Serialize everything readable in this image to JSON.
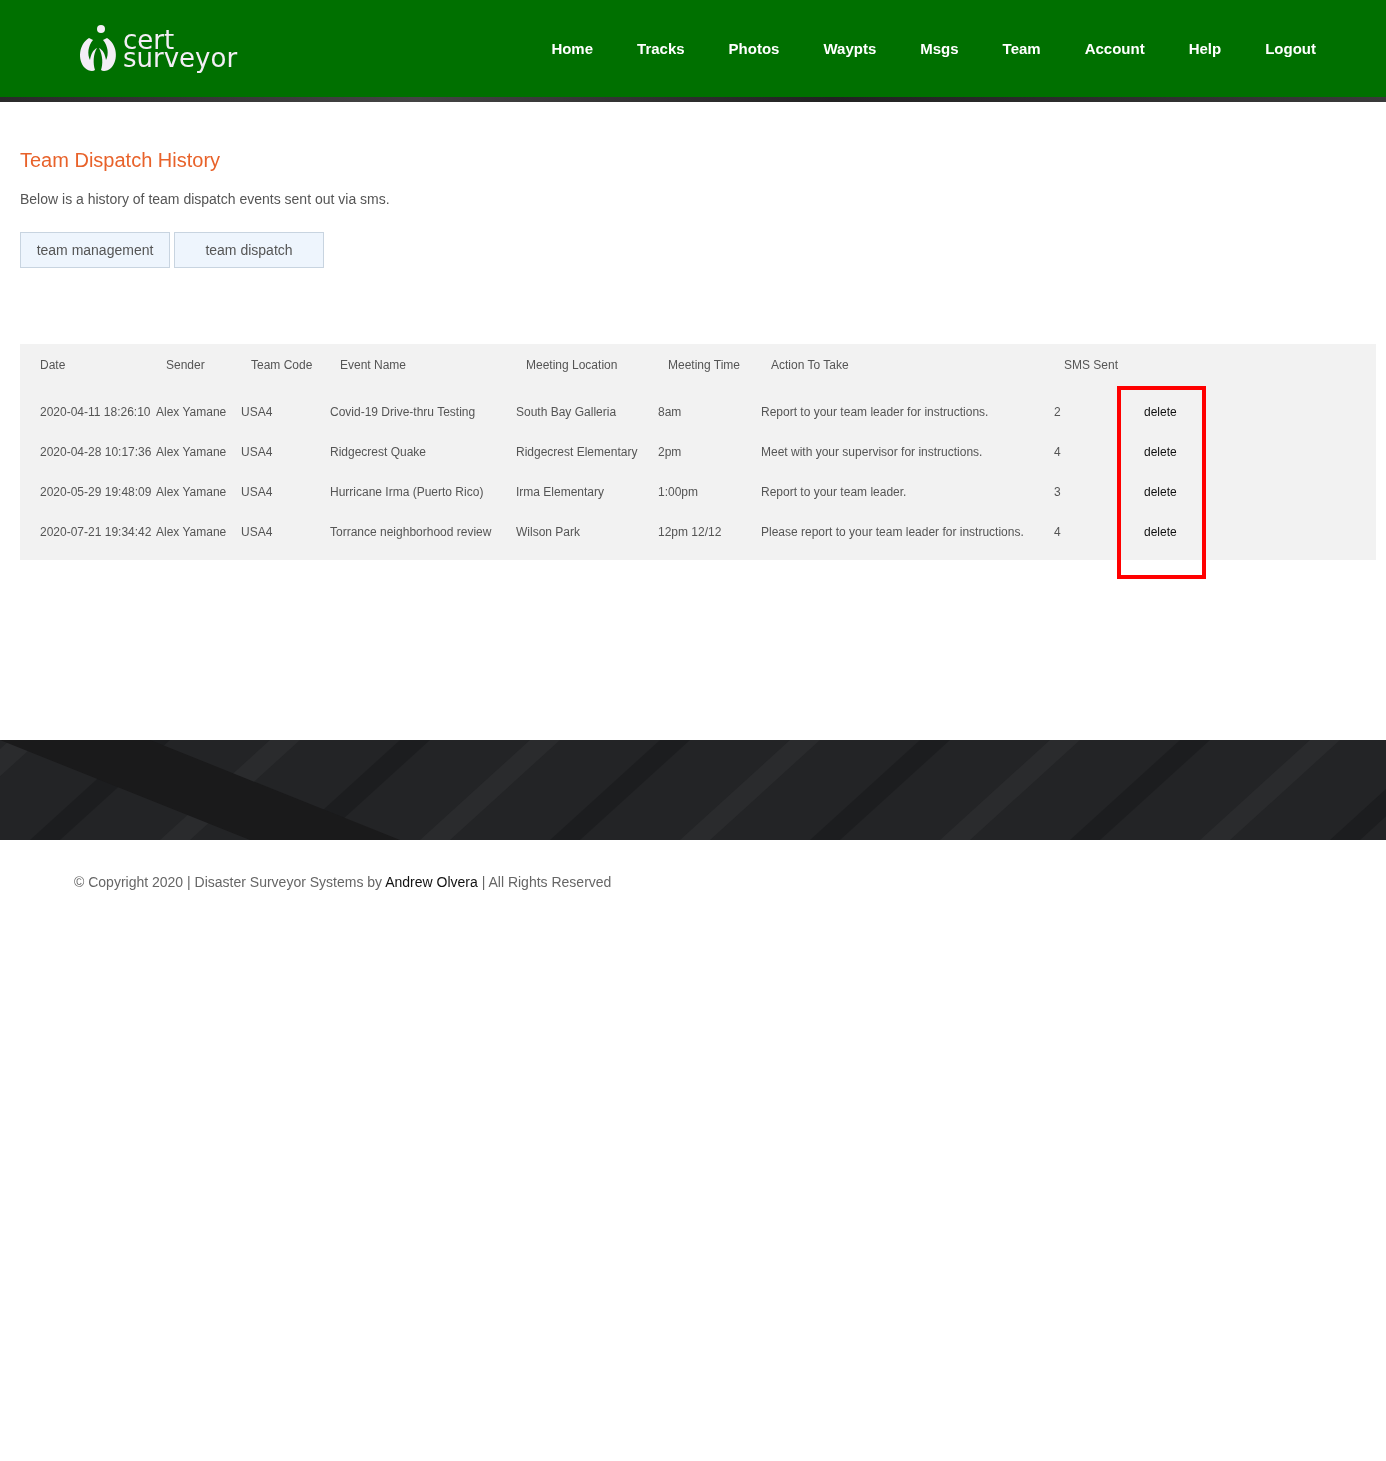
{
  "logo": {
    "line_1": "cert",
    "line_2": "surveyor"
  },
  "nav": [
    "Home",
    "Tracks",
    "Photos",
    "Waypts",
    "Msgs",
    "Team",
    "Account",
    "Help",
    "Logout"
  ],
  "page_title": "Team Dispatch History",
  "intro": "Below is a history of team dispatch events sent out via sms.",
  "buttons": [
    "team management",
    "team dispatch"
  ],
  "table": {
    "columns": [
      "Date",
      "Sender",
      "Team Code",
      "Event Name",
      "Meeting Location",
      "Meeting Time",
      "Action To Take",
      "SMS Sent"
    ],
    "rows": [
      {
        "cells": [
          "2020-04-11 18:26:10",
          "Alex Yamane",
          "USA4",
          "Covid-19 Drive-thru Testing",
          "South Bay Galleria",
          "8am",
          "Report to your team leader for instructions.",
          "2"
        ],
        "action": "delete"
      },
      {
        "cells": [
          "2020-04-28 10:17:36",
          "Alex Yamane",
          "USA4",
          "Ridgecrest Quake",
          "Ridgecrest Elementary",
          "2pm",
          "Meet with your supervisor for instructions.",
          "4"
        ],
        "action": "delete"
      },
      {
        "cells": [
          "2020-05-29 19:48:09",
          "Alex Yamane",
          "USA4",
          "Hurricane Irma (Puerto Rico)",
          "Irma Elementary",
          "1:00pm",
          "Report to your team leader.",
          "3"
        ],
        "action": "delete"
      },
      {
        "cells": [
          "2020-07-21 19:34:42",
          "Alex Yamane",
          "USA4",
          "Torrance neighborhood review",
          "Wilson Park",
          "12pm 12/12",
          "Please report to your team leader for instructions.",
          "4"
        ],
        "action": "delete"
      }
    ]
  },
  "annotation": {
    "kind": "frame",
    "color": "#ff0000"
  },
  "footer": {
    "before": "© Copyright 2020 | Disaster Surveyor Systems by",
    "link": "Andrew Olvera",
    "after": "| All Rights Reserved"
  }
}
